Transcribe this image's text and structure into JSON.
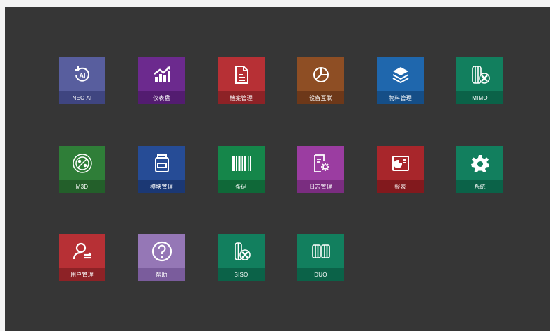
{
  "tiles": [
    {
      "label": "NEO AI",
      "icon": "neo-ai-icon",
      "color": "#585e9e",
      "bar": "#3f4580"
    },
    {
      "label": "仪表盘",
      "icon": "dashboard-chart-icon",
      "color": "#6c2a8e",
      "bar": "#531c70"
    },
    {
      "label": "档案管理",
      "icon": "document-icon",
      "color": "#b73035",
      "bar": "#8d2226"
    },
    {
      "label": "设备互联",
      "icon": "device-connect-icon",
      "color": "#8e4e24",
      "bar": "#6d3819"
    },
    {
      "label": "物料管理",
      "icon": "layers-icon",
      "color": "#1f67ad",
      "bar": "#154e87"
    },
    {
      "label": "MIMO",
      "icon": "mimo-icon",
      "color": "#127f5e",
      "bar": "#0b6248"
    },
    {
      "label": "M3D",
      "icon": "m3d-icon",
      "color": "#2f7e38",
      "bar": "#235f2a"
    },
    {
      "label": "模块管理",
      "icon": "module-box-icon",
      "color": "#264c96",
      "bar": "#1b3874"
    },
    {
      "label": "条码",
      "icon": "barcode-icon",
      "color": "#15864a",
      "bar": "#0f6838"
    },
    {
      "label": "日志管理",
      "icon": "log-settings-icon",
      "color": "#9b3da1",
      "bar": "#7a2d80"
    },
    {
      "label": "报表",
      "icon": "report-icon",
      "color": "#a8262b",
      "bar": "#82191d"
    },
    {
      "label": "系统",
      "icon": "gear-icon",
      "color": "#127f5e",
      "bar": "#0b6248"
    },
    {
      "label": "用户管理",
      "icon": "user-icon",
      "color": "#b73035",
      "bar": "#8d2226"
    },
    {
      "label": "帮助",
      "icon": "help-icon",
      "color": "#9577b6",
      "bar": "#7a5c9c"
    },
    {
      "label": "SISO",
      "icon": "siso-icon",
      "color": "#127f5e",
      "bar": "#0b6248"
    },
    {
      "label": "DUO",
      "icon": "duo-icon",
      "color": "#127f5e",
      "bar": "#0b6248"
    }
  ]
}
